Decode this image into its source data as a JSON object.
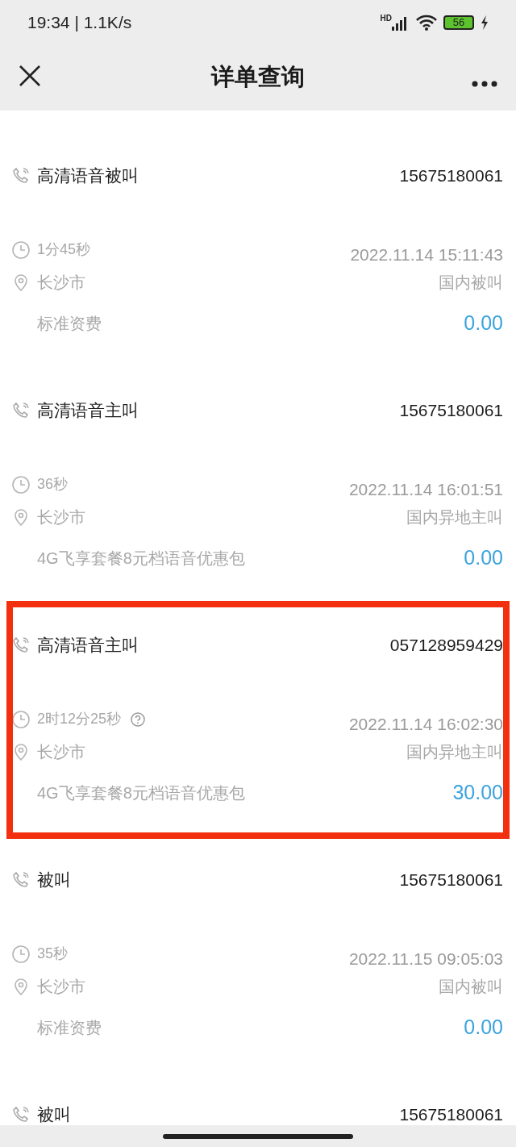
{
  "status_bar": {
    "time": "19:34 | 1.1K/s",
    "network": "HD",
    "battery": "56"
  },
  "header": {
    "title": "详单查询"
  },
  "records": [
    {
      "type": "高清语音被叫",
      "number": "15675180061",
      "duration": "1分45秒",
      "help": false,
      "datetime": "2022.11.14 15:11:43",
      "location": "长沙市",
      "call_kind": "国内被叫",
      "plan": "标准资费",
      "fee": "0.00",
      "highlighted": false
    },
    {
      "type": "高清语音主叫",
      "number": "15675180061",
      "duration": "36秒",
      "help": false,
      "datetime": "2022.11.14 16:01:51",
      "location": "长沙市",
      "call_kind": "国内异地主叫",
      "plan": "4G飞享套餐8元档语音优惠包",
      "fee": "0.00",
      "highlighted": false
    },
    {
      "type": "高清语音主叫",
      "number": "057128959429",
      "duration": "2时12分25秒",
      "help": true,
      "datetime": "2022.11.14 16:02:30",
      "location": "长沙市",
      "call_kind": "国内异地主叫",
      "plan": "4G飞享套餐8元档语音优惠包",
      "fee": "30.00",
      "highlighted": true
    },
    {
      "type": "被叫",
      "number": "15675180061",
      "duration": "35秒",
      "help": false,
      "datetime": "2022.11.15 09:05:03",
      "location": "长沙市",
      "call_kind": "国内被叫",
      "plan": "标准资费",
      "fee": "0.00",
      "highlighted": false
    },
    {
      "type": "被叫",
      "number": "15675180061",
      "highlighted": false
    }
  ]
}
